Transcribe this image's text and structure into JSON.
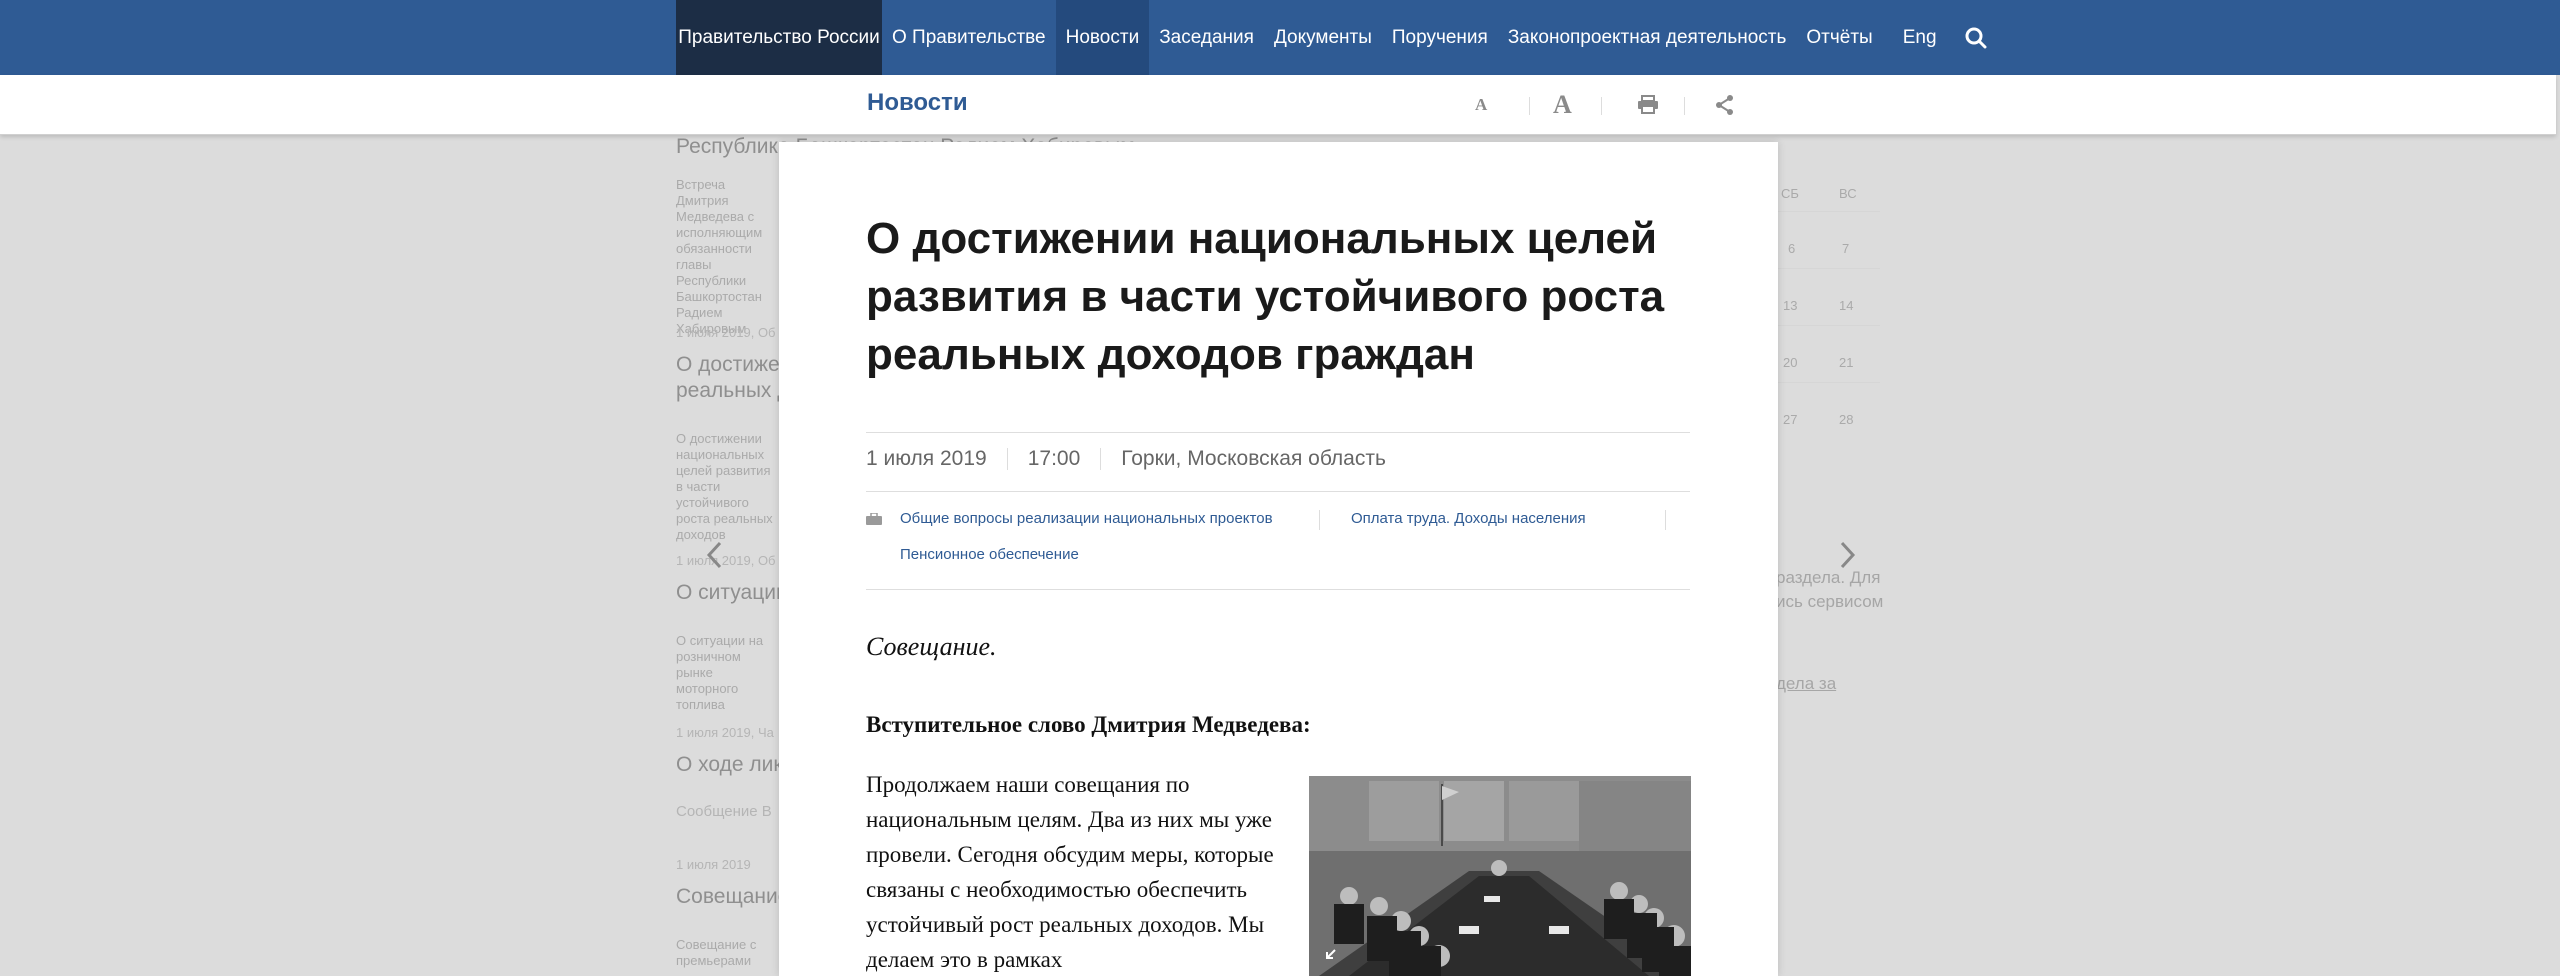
{
  "topnav": {
    "brand": "Правительство России",
    "items": [
      "О Правительстве",
      "Новости",
      "Заседания",
      "Документы",
      "Поручения",
      "Законопроектная деятельность",
      "Отчёты"
    ],
    "lang": "Eng",
    "active": "Новости"
  },
  "subbar": {
    "title": "Новости",
    "font_small": "A",
    "font_big": "A"
  },
  "background": {
    "items": [
      {
        "text": "Республика Башкортостан Радием Хабировым"
      },
      {
        "img": "Встреча Дмитрия Медведева с исполняющим обязанности главы Республики Башкортостан Радием Хабировым"
      },
      {
        "date": "1 июля 2019, Об"
      },
      {
        "head": "О достижении",
        "head2": "реальных д"
      },
      {
        "img": "О достижении национальных целей развития в части устойчивого роста реальных доходов"
      },
      {
        "date": "1 июля 2019, Об"
      },
      {
        "head": "О ситуации"
      },
      {
        "img": "О ситуации на розничном рынке моторного топлива"
      },
      {
        "date": "1 июля 2019, Ча"
      },
      {
        "head": "О ходе лик"
      },
      {
        "sub": "Сообщение В"
      },
      {
        "date": "1 июля 2019"
      },
      {
        "head": "Совещание"
      },
      {
        "img": "Совещание с премьерами"
      }
    ],
    "calendar": {
      "header": [
        "СБ",
        "ВС"
      ],
      "rows": [
        [
          "6",
          "7"
        ],
        [
          "13",
          "14"
        ],
        [
          "20",
          "21"
        ],
        [
          "27",
          "28"
        ]
      ]
    },
    "right_text": [
      "раздела. Для",
      "ись сервисом",
      "дела за"
    ]
  },
  "article": {
    "title": "О достижении национальных целей развития в части устойчивого роста реальных доходов граждан",
    "date": "1 июля 2019",
    "time": "17:00",
    "place": "Горки, Московская область",
    "tags": [
      "Общие вопросы реализации национальных проектов",
      "Оплата труда. Доходы населения",
      "Пенсионное обеспечение"
    ],
    "lead": "Совещание.",
    "subhead": "Вступительное слово Дмитрия Медведева:",
    "body": "Продолжаем наши совещания по национальным целям. Два из них мы уже провели. Сегодня обсудим меры, которые связаны с необходимостью обеспечить устойчивый рост реальных доходов. Мы делаем это в рамках"
  },
  "colors": {
    "nav_bg": "#2f5b94",
    "brand_bg": "#1c2d45",
    "accent": "#2f5b94"
  }
}
